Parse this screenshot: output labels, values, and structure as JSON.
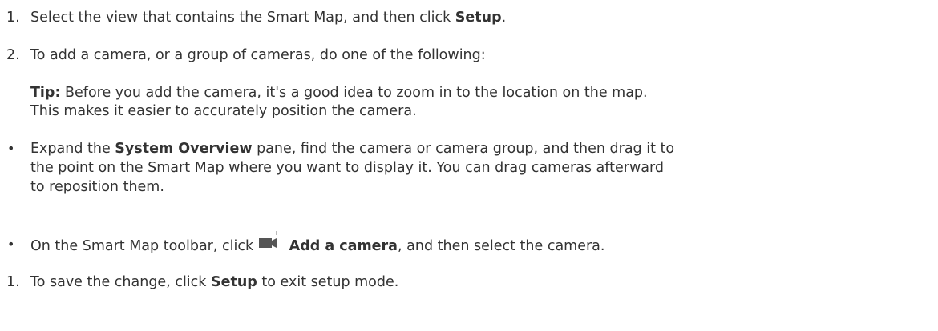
{
  "steps": {
    "step1": {
      "number": "1.",
      "text_before": "Select the view that contains the Smart Map, and then click ",
      "bold": "Setup",
      "text_after": "."
    },
    "step2": {
      "number": "2.",
      "text": "To add a camera, or a group of cameras, do one of the following:"
    },
    "tip": {
      "label": "Tip:",
      "line1": " Before you add the camera, it's a good idea to zoom in to the location on the map.",
      "line2": "This makes it easier to accurately position the camera."
    },
    "bullet1": {
      "bullet": "•",
      "text_before": "Expand the ",
      "bold": "System Overview",
      "line1_after": " pane, find the camera or camera group, and then drag it to",
      "line2": "the point on the Smart Map where you want to display it. You can drag cameras afterward",
      "line3": "to reposition them."
    },
    "bullet2": {
      "bullet": "•",
      "text_before": "On the Smart Map toolbar, click ",
      "bold": "Add a camera",
      "text_after": ", and then select the camera."
    },
    "step3": {
      "number": "1.",
      "text_before": "To save the change, click ",
      "bold": "Setup",
      "text_after": " to exit setup mode."
    }
  },
  "icons": {
    "add_camera": "add-camera-icon"
  },
  "colors": {
    "text": "#333333",
    "icon": "#555555"
  }
}
